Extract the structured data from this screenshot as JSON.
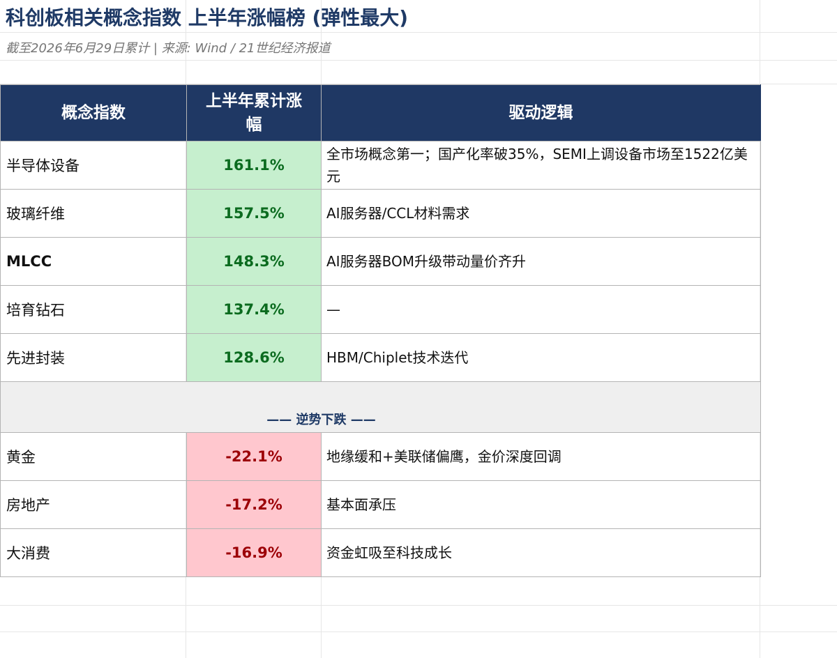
{
  "title": "科创板相关概念指数 上半年涨幅榜 (弹性最大)",
  "subtitle": "截至2026年6月29日累计 | 来源: Wind / 21世纪经济报道",
  "table": {
    "headers": [
      "概念指数",
      "上半年累计涨幅",
      "驱动逻辑"
    ],
    "gainers": [
      {
        "name": "半导体设备",
        "value": "161.1%",
        "logic": "全市场概念第一；国产化率破35%，SEMI上调设备市场至1522亿美元"
      },
      {
        "name": "玻璃纤维",
        "value": "157.5%",
        "logic": "AI服务器/CCL材料需求"
      },
      {
        "name": "MLCC",
        "value": "148.3%",
        "logic": "AI服务器BOM升级带动量价齐升"
      },
      {
        "name": "培育钻石",
        "value": "137.4%",
        "logic": "—"
      },
      {
        "name": "先进封装",
        "value": "128.6%",
        "logic": "HBM/Chiplet技术迭代"
      }
    ],
    "separator": "—— 逆势下跌 ——",
    "losers": [
      {
        "name": "黄金",
        "value": "-22.1%",
        "logic": "地缘缓和+美联储偏鹰，金价深度回调"
      },
      {
        "name": "房地产",
        "value": "-17.2%",
        "logic": "基本面承压"
      },
      {
        "name": "大消费",
        "value": "-16.9%",
        "logic": "资金虹吸至科技成长"
      }
    ]
  },
  "colors": {
    "header_bg": "#1f3864",
    "gain_bg": "#c6efce",
    "gain_text": "#0b6b1f",
    "loss_bg": "#ffc7ce",
    "loss_text": "#9c0006",
    "title_color": "#1f3a66"
  }
}
